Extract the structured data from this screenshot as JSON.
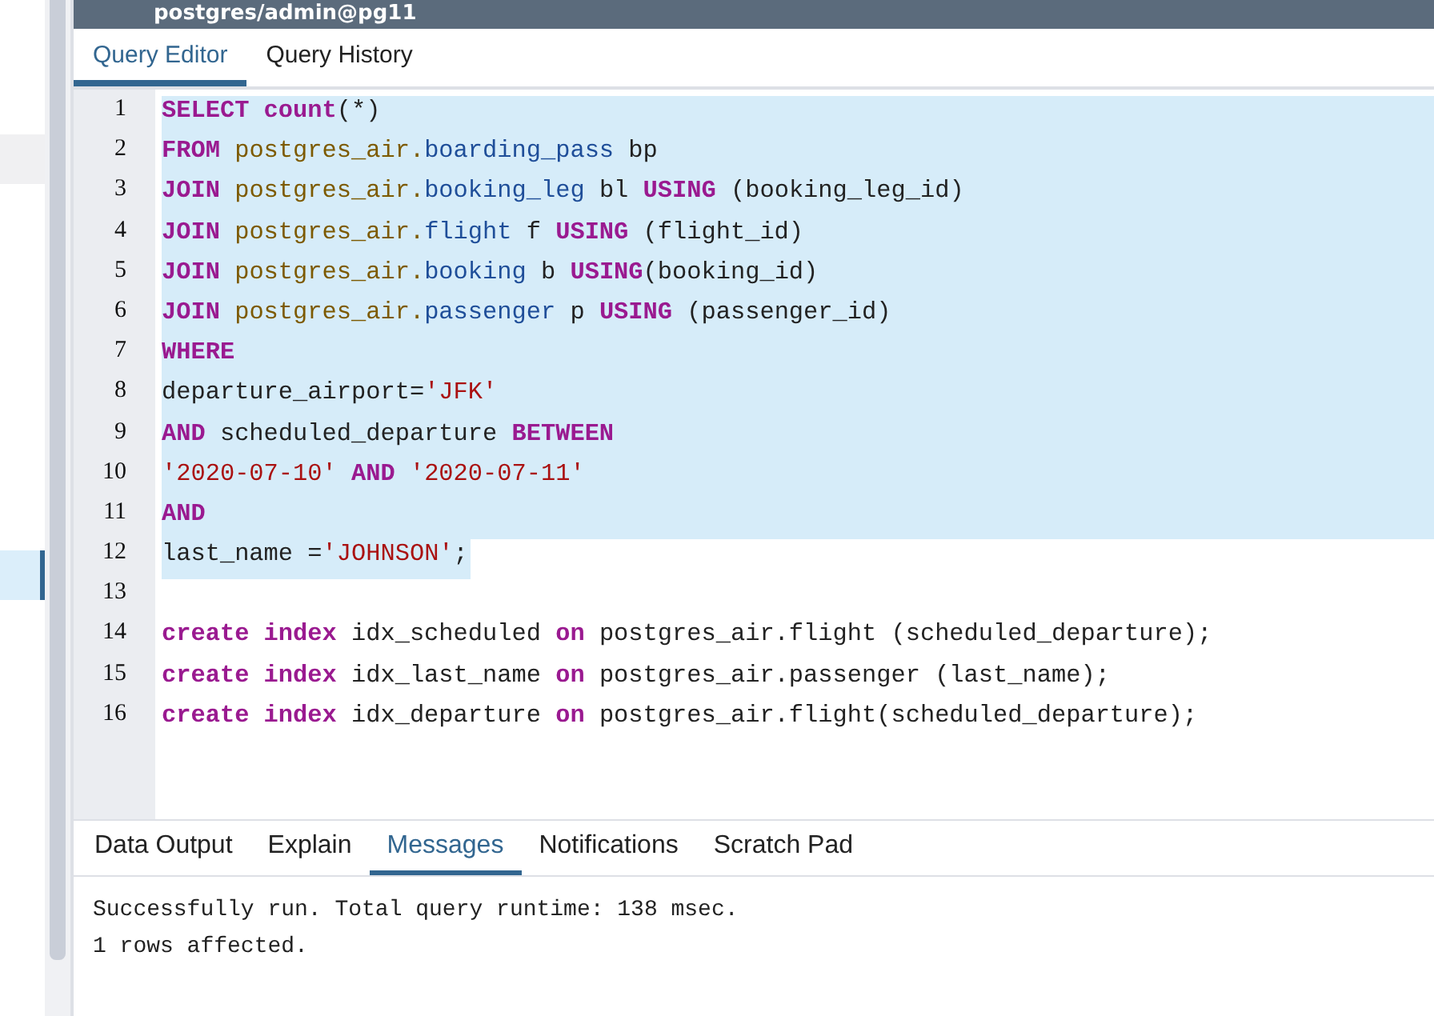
{
  "connection": {
    "title": "postgres/admin@pg11"
  },
  "sidebar": {
    "rows": [
      {
        "selected": false
      },
      {
        "selected": true
      }
    ]
  },
  "editor_tabs": [
    {
      "label": "Query Editor",
      "selected": true
    },
    {
      "label": "Query History",
      "selected": false
    }
  ],
  "code_lines": [
    {
      "number": "1",
      "selected": true,
      "tokens": [
        {
          "kind": "keyword",
          "text": "SELECT count"
        },
        {
          "kind": "plain",
          "text": "(*)"
        }
      ]
    },
    {
      "number": "2",
      "selected": true,
      "tokens": [
        {
          "kind": "keyword",
          "text": "FROM "
        },
        {
          "kind": "variable",
          "text": "postgres_air."
        },
        {
          "kind": "property",
          "text": "boarding_pass"
        },
        {
          "kind": "plain",
          "text": " bp"
        }
      ]
    },
    {
      "number": "3",
      "selected": true,
      "tokens": [
        {
          "kind": "keyword",
          "text": "JOIN "
        },
        {
          "kind": "variable",
          "text": "postgres_air."
        },
        {
          "kind": "property",
          "text": "booking_leg"
        },
        {
          "kind": "plain",
          "text": " bl "
        },
        {
          "kind": "keyword",
          "text": "USING"
        },
        {
          "kind": "plain",
          "text": " (booking_leg_id)"
        }
      ]
    },
    {
      "number": "4",
      "selected": true,
      "tokens": [
        {
          "kind": "keyword",
          "text": "JOIN "
        },
        {
          "kind": "variable",
          "text": "postgres_air."
        },
        {
          "kind": "property",
          "text": "flight"
        },
        {
          "kind": "plain",
          "text": " f "
        },
        {
          "kind": "keyword",
          "text": "USING"
        },
        {
          "kind": "plain",
          "text": " (flight_id)"
        }
      ]
    },
    {
      "number": "5",
      "selected": true,
      "tokens": [
        {
          "kind": "keyword",
          "text": "JOIN "
        },
        {
          "kind": "variable",
          "text": "postgres_air."
        },
        {
          "kind": "property",
          "text": "booking"
        },
        {
          "kind": "plain",
          "text": " b "
        },
        {
          "kind": "keyword",
          "text": "USING"
        },
        {
          "kind": "plain",
          "text": "(booking_id)"
        }
      ]
    },
    {
      "number": "6",
      "selected": true,
      "tokens": [
        {
          "kind": "keyword",
          "text": "JOIN "
        },
        {
          "kind": "variable",
          "text": "postgres_air."
        },
        {
          "kind": "property",
          "text": "passenger"
        },
        {
          "kind": "plain",
          "text": " p "
        },
        {
          "kind": "keyword",
          "text": "USING"
        },
        {
          "kind": "plain",
          "text": " (passenger_id)"
        }
      ]
    },
    {
      "number": "7",
      "selected": true,
      "tokens": [
        {
          "kind": "keyword",
          "text": "WHERE"
        }
      ]
    },
    {
      "number": "8",
      "selected": true,
      "tokens": [
        {
          "kind": "plain",
          "text": "departure_airport="
        },
        {
          "kind": "string",
          "text": "'JFK'"
        }
      ]
    },
    {
      "number": "9",
      "selected": true,
      "tokens": [
        {
          "kind": "keyword",
          "text": "AND"
        },
        {
          "kind": "plain",
          "text": " scheduled_departure "
        },
        {
          "kind": "keyword",
          "text": "BETWEEN"
        }
      ]
    },
    {
      "number": "10",
      "selected": true,
      "tokens": [
        {
          "kind": "string",
          "text": "'2020-07-10'"
        },
        {
          "kind": "keyword",
          "text": " AND "
        },
        {
          "kind": "string",
          "text": "'2020-07-11'"
        }
      ]
    },
    {
      "number": "11",
      "selected": true,
      "tokens": [
        {
          "kind": "keyword",
          "text": "AND"
        }
      ]
    },
    {
      "number": "12",
      "selected": true,
      "tokens": [
        {
          "kind": "plain",
          "text": "last_name ="
        },
        {
          "kind": "string",
          "text": "'JOHNSON'"
        },
        {
          "kind": "plain",
          "text": ";"
        }
      ]
    },
    {
      "number": "13",
      "selected": false
    },
    {
      "number": "14",
      "selected": false,
      "tokens": [
        {
          "kind": "keyword",
          "text": "create index"
        },
        {
          "kind": "plain",
          "text": " idx_scheduled "
        },
        {
          "kind": "keyword",
          "text": "on"
        },
        {
          "kind": "plain",
          "text": " postgres_air.flight (scheduled_departure);"
        }
      ]
    },
    {
      "number": "15",
      "selected": false,
      "tokens": [
        {
          "kind": "keyword",
          "text": "create index"
        },
        {
          "kind": "plain",
          "text": " idx_last_name "
        },
        {
          "kind": "keyword",
          "text": "on"
        },
        {
          "kind": "plain",
          "text": " postgres_air.passenger (last_name);"
        }
      ]
    },
    {
      "number": "16",
      "selected": false,
      "tokens": [
        {
          "kind": "keyword",
          "text": "create index"
        },
        {
          "kind": "plain",
          "text": " idx_departure "
        },
        {
          "kind": "keyword",
          "text": "on"
        },
        {
          "kind": "plain",
          "text": " postgres_air.flight(scheduled_departure);"
        }
      ]
    }
  ],
  "output_tabs": [
    {
      "label": "Data Output",
      "selected": false
    },
    {
      "label": "Explain",
      "selected": false
    },
    {
      "label": "Messages",
      "selected": true
    },
    {
      "label": "Notifications",
      "selected": false
    },
    {
      "label": "Scratch Pad",
      "selected": false
    }
  ],
  "messages": [
    "Successfully run. Total query runtime: 138 msec.",
    "1 rows affected."
  ]
}
